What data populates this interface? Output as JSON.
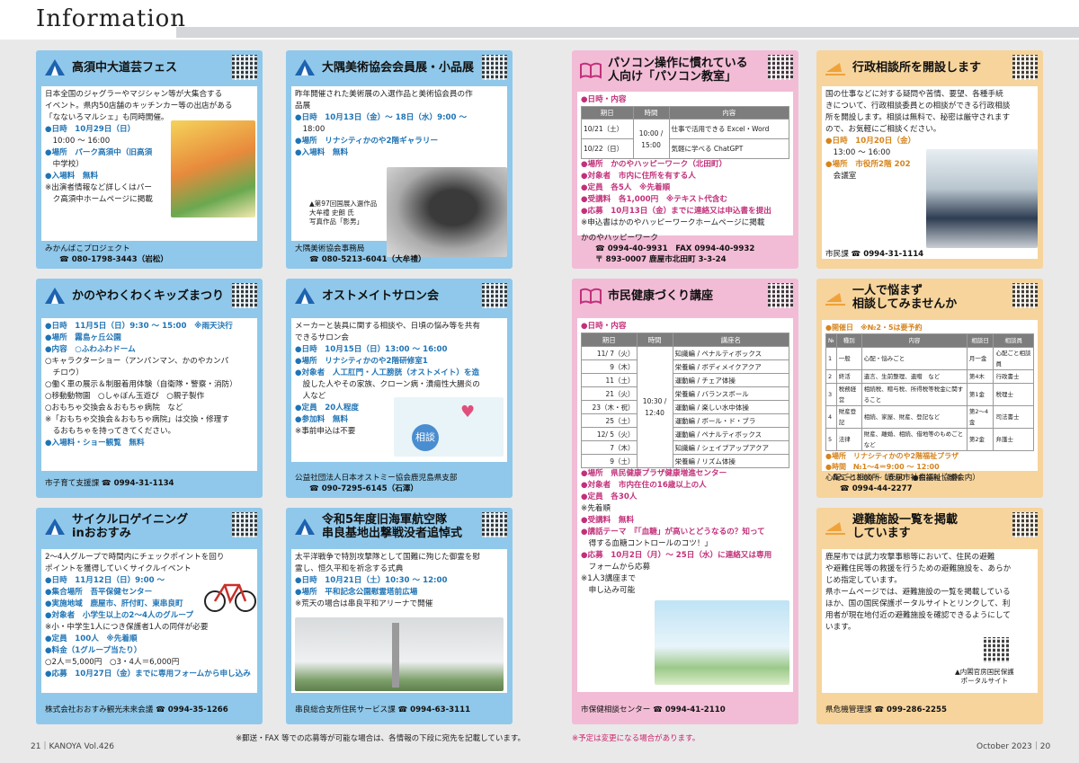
{
  "header": {
    "title": "Information"
  },
  "cards": {
    "c1": {
      "title": "高須中大道芸フェス",
      "lines": [
        "日本全国のジャグラーやマジシャン等が大集合する",
        "イベント。県内50店舗のキッチンカー等の出店がある",
        "「なないろマルシェ」も同時開催。",
        "●日時　10月29日（日）",
        "　10:00 ～ 16:00",
        "●場所　パーク高須中（旧高須",
        "　中学校）",
        "●入場料　無料",
        "※出演者情報など詳しくはパー",
        "　ク高須中ホームページに掲載"
      ],
      "org": "みかんばこプロジェクト",
      "tel": "☎ 080-1798-3443（岩松）"
    },
    "c2": {
      "title": "大隅美術協会会員展・小品展",
      "lines": [
        "昨年開催された美術展の入選作品と美術協会員の作",
        "品展",
        "●日時　10月13日（金）～ 18日（水）9:00 ～",
        "　18:00",
        "●場所　リナシティかのや2階ギャラリー",
        "●入場料　無料"
      ],
      "caption": [
        "▲第97回国展入選作品",
        "大牟禮 史朗 氏",
        "写真作品「影男」"
      ],
      "org": "大隅美術協会事務局",
      "tel": "☎ 080-5213-6041（大牟禮）"
    },
    "c3": {
      "title_l1": "パソコン操作に慣れている",
      "title_l2": "人向け「パソコン教室」",
      "sec": "●日時・内容",
      "th": [
        "期日",
        "時間",
        "内容"
      ],
      "rows": [
        [
          "10/21（土）",
          "仕事で活用できる Excel・Word"
        ],
        [
          "10/22（日）",
          "気軽に学べる ChatGPT"
        ]
      ],
      "time": "10:00 / 15:00",
      "lines": [
        "●場所　かのやハッピーワーク（北田町）",
        "●対象者　市内に住所を有する人",
        "●定員　各5人　※先着順",
        "●受講料　各1,000円　※テキスト代含む",
        "●応募　10月13日（金）までに連絡又は申込書を提出",
        "※申込書はかのやハッピーワークホームページに掲載"
      ],
      "org": "かのやハッピーワーク",
      "tel": "☎ 0994-40-9931　FAX 0994-40-9932",
      "addr": "〒 893-0007 鹿屋市北田町 3-3-24"
    },
    "c4": {
      "title": "行政相談所を開設します",
      "lines": [
        "国の仕事などに対する疑問や苦情、要望、各種手続",
        "きについて、行政相談委員との相談ができる行政相談",
        "所を開設します。相談は無料で、秘密は厳守されます",
        "ので、お気軽にご相談ください。",
        "●日時　10月20日（金）",
        "　13:00 ～ 16:00",
        "●場所　市役所2階 202",
        "　会議室"
      ],
      "org": "市民課",
      "tel": "☎ 0994-31-1114"
    },
    "c5": {
      "title": "かのやわくわくキッズまつり",
      "lines": [
        "●日時　11月5日（日）9:30 ～ 15:00　※雨天決行",
        "●場所　霧島ヶ丘公園",
        "●内容　○ふわふわドーム",
        "○キャラクターショー（アンパンマン、かのやカンパ",
        "　チロウ）",
        "○働く車の展示＆制服着用体験（自衛隊・警察・消防）",
        "○移動動物園　○しゃぼん玉遊び　○親子製作",
        "○おもちゃ交換会＆おもちゃ病院　など",
        "※「おもちゃ交換会＆おもちゃ病院」は交換・修理す",
        "　るおもちゃを持ってきてください。",
        "●入場料・ショー観覧　無料"
      ],
      "org": "市子育て支援課",
      "tel": "☎ 0994-31-1134"
    },
    "c6": {
      "title": "オストメイトサロン会",
      "lines": [
        "メーカーと装具に関する相談や、日頃の悩み等を共有",
        "できるサロン会",
        "●日時　10月15日（日）13:00 ～ 16:00",
        "●場所　リナシティかのや2階研修室1",
        "●対象者　人工肛門・人工膀胱（オストメイト）を造",
        "　設した人やその家族、クローン病・潰瘍性大腸炎の",
        "　人など",
        "●定員　20人程度",
        "●参加料　無料",
        "※事前申込は不要"
      ],
      "org": "公益社団法人日本オストミー協会鹿児島県支部",
      "tel": "☎ 090-7295-6145（石澤）",
      "badge": "相談"
    },
    "c7": {
      "title": "市民健康づくり講座",
      "sec": "●日時・内容",
      "th": [
        "期日",
        "時間",
        "講座名"
      ],
      "rows": [
        [
          "11/ 7（火）",
          "知識編 / ペナルティボックス"
        ],
        [
          "9（木）",
          "栄養編 / ボディメイクアクア"
        ],
        [
          "11（土）",
          "運動編 / チェア体操"
        ],
        [
          "21（火）",
          "栄養編 / バランスボール"
        ],
        [
          "23（木・祝）",
          "運動編 / 楽しい水中体操"
        ],
        [
          "25（土）",
          "運動編 / ボール・ド・ブラ"
        ],
        [
          "12/ 5（火）",
          "運動編 / ペナルティボックス"
        ],
        [
          "7（木）",
          "知識編 / シェイプアップアクア"
        ],
        [
          "9（土）",
          "栄養編 / リズム体操"
        ]
      ],
      "time": "10:30 / 12:40",
      "lines": [
        "●場所　県民健康プラザ健康増進センター",
        "●対象者　市内在住の16歳以上の人",
        "●定員　各30人",
        "※先着順",
        "●受講料　無料",
        "●講話テーマ　『「血糖」が高いとどうなるの？知って",
        "　得する血糖コントロールのコツ！」",
        "●応募　10月2日（月）～ 25日（水）に連絡又は専用",
        "　フォームから応募",
        "※1人3講座まで",
        "　申し込み可能"
      ],
      "org": "市保健相談センター",
      "tel": "☎ 0994-41-2110"
    },
    "c8": {
      "title_l1": "一人で悩まず",
      "title_l2": "相談してみませんか",
      "sec": "●開催日　※№2・5は要予約",
      "th": [
        "№",
        "種別",
        "内容",
        "相談日",
        "相談員"
      ],
      "rows": [
        [
          "1",
          "一般",
          "心配・悩みごと",
          "月一金",
          "心配ごと相談員"
        ],
        [
          "2",
          "終活",
          "遺言、生前整理、遺贈　など",
          "第4木",
          "行政書士"
        ],
        [
          "3",
          "税務経営",
          "相続税、贈与税、所得税等税金に関すること",
          "第1金",
          "税理士"
        ],
        [
          "4",
          "財産登記",
          "相続、家屋、財産、登記など",
          "第2～4金",
          "司法書士"
        ],
        [
          "5",
          "法律",
          "財産、離婚、相続、借地等のもめごと　など",
          "第2金",
          "弁護士"
        ]
      ],
      "lines": [
        "●場所　リナシティかのや2階福祉プラザ",
        "●時間　№1～4＝9:00 ～ 12:00",
        "　№5＝13:00 ～ 16:00　●相談料　無料"
      ],
      "org": "心配ごと相談所（鹿屋市社会福祉協議会内）",
      "tel": "☎ 0994-44-2277"
    },
    "c9": {
      "title_l1": "サイクルロゲイニング",
      "title_l2": "inおおすみ",
      "lines": [
        "2～4人グループで時間内にチェックポイントを回り",
        "ポイントを獲得していくサイクルイベント",
        "●日時　11月12日（日）9:00 ～",
        "●集合場所　吾平保健センター",
        "●実施地域　鹿屋市、肝付町、東串良町",
        "●対象者　小学生以上の2～4人のグループ",
        "※小・中学生1人につき保護者1人の同伴が必要",
        "●定員　100人　※先着順",
        "●料金（1グループ当たり）",
        "○2人＝5,000円　○3・4人＝6,000円",
        "●応募　10月27日（金）までに専用フォームから申し込み"
      ],
      "org": "株式会社おおすみ観光未来会議",
      "tel": "☎ 0994-35-1266"
    },
    "c10": {
      "title_l1": "令和5年度旧海軍航空隊",
      "title_l2": "串良基地出撃戦没者追悼式",
      "lines": [
        "太平洋戦争で特別攻撃隊として国難に殉じた御霊を慰",
        "霊し、恒久平和を祈念する式典",
        "●日時　10月21日（土）10:30 ～ 12:00",
        "●場所　平和記念公園慰霊塔前広場",
        "※荒天の場合は串良平和アリーナで開催"
      ],
      "org": "串良総合支所住民サービス課",
      "tel": "☎ 0994-63-3111"
    },
    "c11": {
      "title_l1": "避難施設一覧を掲載",
      "title_l2": "しています",
      "lines": [
        "鹿屋市では武力攻撃事態等において、住民の避難",
        "や避難住民等の救援を行うための避難施設を、あらか",
        "じめ指定しています。",
        "県ホームページでは、避難施設の一覧を掲載している",
        "ほか、国の国民保護ポータルサイトとリンクして、利",
        "用者が現在地付近の避難施設を確認できるようにして",
        "います。"
      ],
      "caption": [
        "▲内閣官房国民保護",
        "ポータルサイト"
      ],
      "org": "県危機管理課",
      "tel": "☎ 099-286-2255"
    }
  },
  "footer": {
    "left": "21｜KANOYA Vol.426",
    "right": "October 2023｜20",
    "note1": "※郵送・FAX 等での応募等が可能な場合は、各情報の下段に宛先を記載しています。",
    "note2": "※予定は変更になる場合があります。"
  }
}
